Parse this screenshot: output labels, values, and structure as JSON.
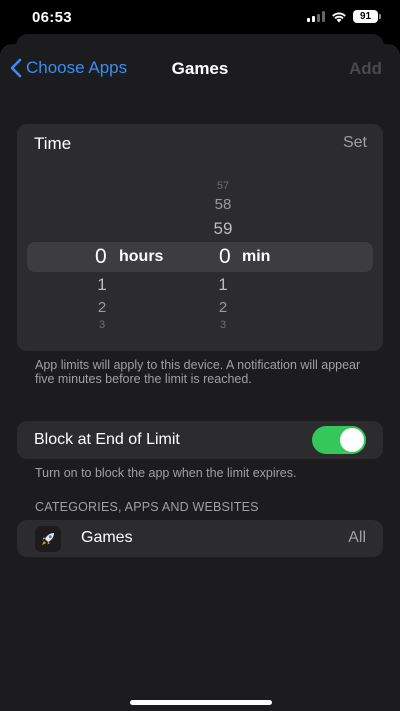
{
  "status": {
    "time": "06:53",
    "battery": "91"
  },
  "nav": {
    "back_label": "Choose Apps",
    "title": "Games",
    "add_label": "Add"
  },
  "time_card": {
    "label": "Time",
    "action": "Set",
    "hours_above": [
      "",
      "",
      ""
    ],
    "minutes_above": [
      "57",
      "58",
      "59"
    ],
    "selected_hours": "0",
    "hours_unit": "hours",
    "selected_minutes": "0",
    "minutes_unit": "min",
    "hours_below": [
      "1",
      "2",
      "3"
    ],
    "minutes_below": [
      "1",
      "2",
      "3"
    ]
  },
  "limit_note": "App limits will apply to this device. A notification will appear five minutes before the limit is reached.",
  "block": {
    "label": "Block at End of Limit",
    "enabled": true,
    "note": "Turn on to block the app when the limit expires."
  },
  "section_header": "CATEGORIES, APPS AND WEBSITES",
  "category_row": {
    "icon": "rocket-icon",
    "label": "Games",
    "value": "All"
  },
  "colors": {
    "accent": "#3b8cf5",
    "toggle_on": "#35c759",
    "background": "#1c1c1e",
    "card": "#2c2c2e"
  }
}
